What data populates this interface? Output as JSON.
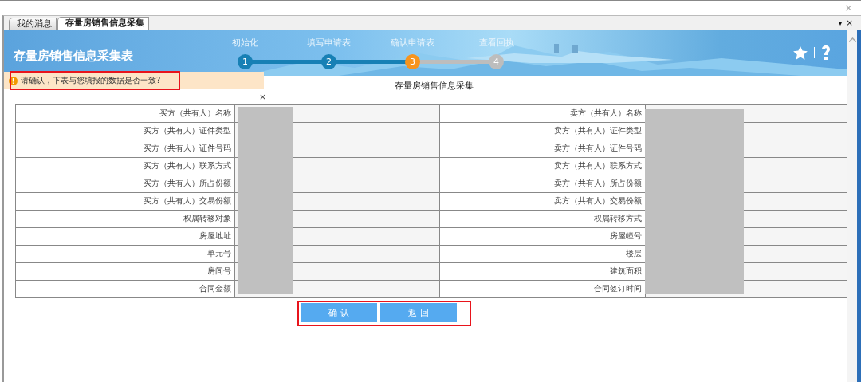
{
  "window": {
    "close": "×",
    "tab_menu": "▾",
    "tab_close": "×"
  },
  "tabs": [
    {
      "label": "我的消息",
      "selected": false
    },
    {
      "label": "存量房销售信息采集",
      "selected": true
    }
  ],
  "header": {
    "title": "存量房销售信息采集表",
    "steps": [
      {
        "label": "初始化",
        "number": "1",
        "done": true,
        "selected": false
      },
      {
        "label": "填写申请表",
        "number": "2",
        "done": true,
        "selected": false
      },
      {
        "label": "确认申请表",
        "number": "3",
        "done": false,
        "selected": true
      },
      {
        "label": "查看回执",
        "number": "4",
        "done": false,
        "selected": false
      }
    ]
  },
  "alert": {
    "text": "请确认，下表与您填报的数据是否一致?",
    "highlighted": true,
    "close": "×"
  },
  "form": {
    "title": "存量房销售信息采集",
    "rows": [
      {
        "left_label": "买方（共有人）名称",
        "right_label": "卖方（共有人）名称"
      },
      {
        "left_label": "买方（共有人）证件类型",
        "right_label": "卖方（共有人）证件类型"
      },
      {
        "left_label": "买方（共有人）证件号码",
        "right_label": "卖方（共有人）证件号码"
      },
      {
        "left_label": "买方（共有人）联系方式",
        "right_label": "卖方（共有人）联系方式"
      },
      {
        "left_label": "买方（共有人）所占份额",
        "right_label": "卖方（共有人）所占份额"
      },
      {
        "left_label": "买方（共有人）交易份额",
        "right_label": "卖方（共有人）交易份额"
      },
      {
        "left_label": "权属转移对象",
        "right_label": "权属转移方式"
      },
      {
        "left_label": "房屋地址",
        "right_label": "房屋幢号"
      },
      {
        "left_label": "单元号",
        "right_label": "楼层"
      },
      {
        "left_label": "房间号",
        "right_label": "建筑面积"
      },
      {
        "left_label": "合同金额",
        "right_label": "合同签订时间"
      }
    ]
  },
  "buttons": {
    "highlighted": true,
    "items": [
      {
        "label": "确 认"
      },
      {
        "label": "返 回"
      }
    ]
  }
}
